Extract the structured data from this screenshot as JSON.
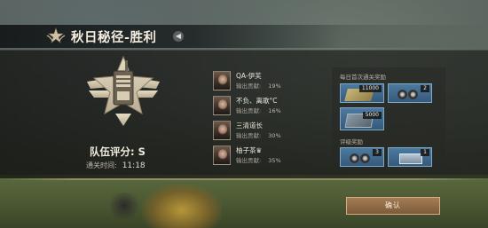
{
  "title": {
    "text": "秋日秘径-胜利",
    "emblem_icon": "star-wings-emblem-icon",
    "sound_icon": "speaker-icon"
  },
  "summary": {
    "team_score_label": "队伍评分: S",
    "clear_time_label": "通关时间:",
    "clear_time_value": "11:18",
    "badge_icon": "radio-winged-badge-icon"
  },
  "players": [
    {
      "name": "QA-伊芙",
      "contrib_label": "输出贡献:",
      "contrib_value": "19%"
    },
    {
      "name": "不负、离歌°C",
      "contrib_label": "输出贡献:",
      "contrib_value": "16%"
    },
    {
      "name": "三清道长",
      "contrib_label": "输出贡献:",
      "contrib_value": "30%"
    },
    {
      "name": "柚子茶♛",
      "contrib_label": "输出贡献:",
      "contrib_value": "35%"
    }
  ],
  "rewards": {
    "first_clear_title": "每日首次通关奖励",
    "first_clear_items": [
      {
        "icon": "ammo-icon",
        "qty": "11000"
      },
      {
        "icon": "tire-icon",
        "qty": "2"
      },
      {
        "icon": "parts-icon",
        "qty": "5000"
      }
    ],
    "rating_title": "评级奖励",
    "rating_items": [
      {
        "icon": "tire-icon",
        "qty": "3"
      },
      {
        "icon": "supply-box-icon",
        "qty": "1"
      }
    ]
  },
  "confirm_label": "确认",
  "colors": {
    "accent_gold": "#d3ae80",
    "item_blue": "#4d7aa0",
    "text_light": "#f2ece0"
  }
}
